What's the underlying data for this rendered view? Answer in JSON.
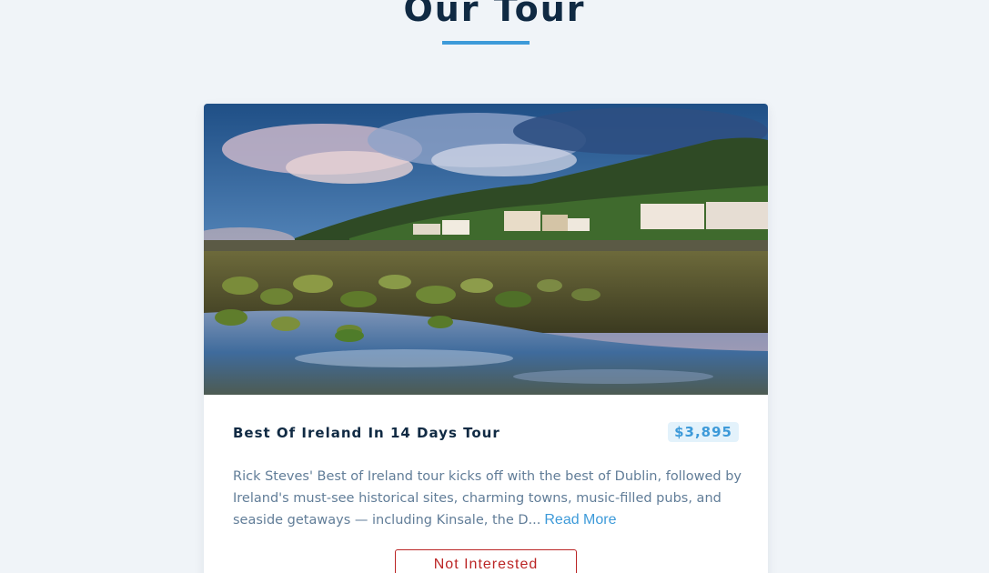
{
  "header": {
    "title": "Our Tour"
  },
  "tour": {
    "name": "Best Of Ireland In 14 Days Tour",
    "price": "$3,895",
    "info": "Rick Steves' Best of Ireland tour kicks off with the best of Dublin, followed by Ireland's must-see historical sites, charming towns, music-filled pubs, and seaside getaways — including Kinsale, the D...",
    "read_more_label": "Read More",
    "not_interested_label": "Not Interested",
    "image_alt": "Coastal village with mossy rocks"
  },
  "colors": {
    "background": "#f0f4f8",
    "accent": "#3d9ad9",
    "heading": "#102a43",
    "text": "#617d98",
    "danger": "#bb2525",
    "price_bg": "#e3f2fb"
  }
}
